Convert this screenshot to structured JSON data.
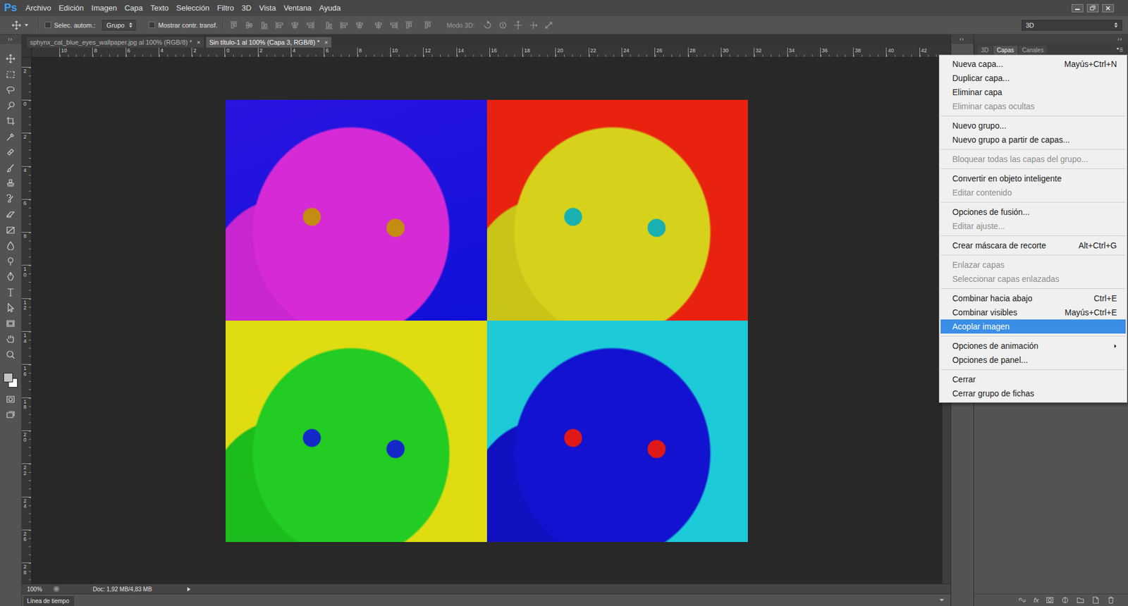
{
  "app": {
    "logo": "Ps"
  },
  "menubar": [
    "Archivo",
    "Edición",
    "Imagen",
    "Capa",
    "Texto",
    "Selección",
    "Filtro",
    "3D",
    "Vista",
    "Ventana",
    "Ayuda"
  ],
  "options_bar": {
    "checkboxes": [
      {
        "label": "Selec. autom.:",
        "checked": false
      },
      {
        "label": "Mostrar contr. transf.",
        "checked": false
      }
    ],
    "dropdown": "Grupo",
    "mode_3d": "Modo 3D:",
    "workspace": "3D"
  },
  "tabs": [
    {
      "label": "sphynx_cat_blue_eyes_wallpaper.jpg al 100% (RGB/8) *",
      "close": "×",
      "selected": false
    },
    {
      "label": "Sin título-1 al 100% (Capa 3, RGB/8) *",
      "close": "×",
      "selected": true
    }
  ],
  "rulers": {
    "horizontal": [
      "10",
      "8",
      "6",
      "4",
      "2",
      "0",
      "2",
      "4",
      "6",
      "8",
      "10",
      "12",
      "14",
      "16",
      "18",
      "20",
      "22",
      "24",
      "26",
      "28",
      "30",
      "32",
      "34",
      "36",
      "38",
      "40",
      "42"
    ],
    "vertical": [
      "2",
      "0",
      "2",
      "4",
      "6",
      "8",
      "10",
      "12",
      "14",
      "16",
      "18",
      "20",
      "22",
      "24",
      "26",
      "28"
    ]
  },
  "status_bar": {
    "zoom": "100%",
    "doc": "Doc: 1,92 MB/4,83 MB"
  },
  "timeline": {
    "label": "Línea de tiempo"
  },
  "panel": {
    "tabs": [
      {
        "label": "3D",
        "selected": false
      },
      {
        "label": "Capas",
        "selected": true
      },
      {
        "label": "Canales",
        "selected": false
      }
    ],
    "footer_fx": "fx"
  },
  "context_menu": {
    "groups": [
      [
        {
          "label": "Nueva capa...",
          "shortcut": "Mayús+Ctrl+N",
          "disabled": false,
          "selected": false,
          "submenu": false
        },
        {
          "label": "Duplicar capa...",
          "disabled": false,
          "selected": false,
          "submenu": false
        },
        {
          "label": "Eliminar capa",
          "disabled": false,
          "selected": false,
          "submenu": false
        },
        {
          "label": "Eliminar capas ocultas",
          "disabled": true,
          "selected": false,
          "submenu": false
        }
      ],
      [
        {
          "label": "Nuevo grupo...",
          "disabled": false,
          "selected": false,
          "submenu": false
        },
        {
          "label": "Nuevo grupo a partir de capas...",
          "disabled": false,
          "selected": false,
          "submenu": false
        }
      ],
      [
        {
          "label": "Bloquear todas las capas del grupo...",
          "disabled": true,
          "selected": false,
          "submenu": false
        }
      ],
      [
        {
          "label": "Convertir en objeto inteligente",
          "disabled": false,
          "selected": false,
          "submenu": false
        },
        {
          "label": "Editar contenido",
          "disabled": true,
          "selected": false,
          "submenu": false
        }
      ],
      [
        {
          "label": "Opciones de fusión...",
          "disabled": false,
          "selected": false,
          "submenu": false
        },
        {
          "label": "Editar ajuste...",
          "disabled": true,
          "selected": false,
          "submenu": false
        }
      ],
      [
        {
          "label": "Crear máscara de recorte",
          "shortcut": "Alt+Ctrl+G",
          "disabled": false,
          "selected": false,
          "submenu": false
        }
      ],
      [
        {
          "label": "Enlazar capas",
          "disabled": true,
          "selected": false,
          "submenu": false
        },
        {
          "label": "Seleccionar capas enlazadas",
          "disabled": true,
          "selected": false,
          "submenu": false
        }
      ],
      [
        {
          "label": "Combinar hacia abajo",
          "shortcut": "Ctrl+E",
          "disabled": false,
          "selected": false,
          "submenu": false
        },
        {
          "label": "Combinar visibles",
          "shortcut": "Mayús+Ctrl+E",
          "disabled": false,
          "selected": false,
          "submenu": false
        },
        {
          "label": "Acoplar imagen",
          "disabled": false,
          "selected": true,
          "submenu": false
        }
      ],
      [
        {
          "label": "Opciones de animación",
          "disabled": false,
          "selected": false,
          "submenu": true
        },
        {
          "label": "Opciones de panel...",
          "disabled": false,
          "selected": false,
          "submenu": false
        }
      ],
      [
        {
          "label": "Cerrar",
          "disabled": false,
          "selected": false,
          "submenu": false
        },
        {
          "label": "Cerrar grupo de fichas",
          "disabled": false,
          "selected": false,
          "submenu": false
        }
      ]
    ]
  }
}
